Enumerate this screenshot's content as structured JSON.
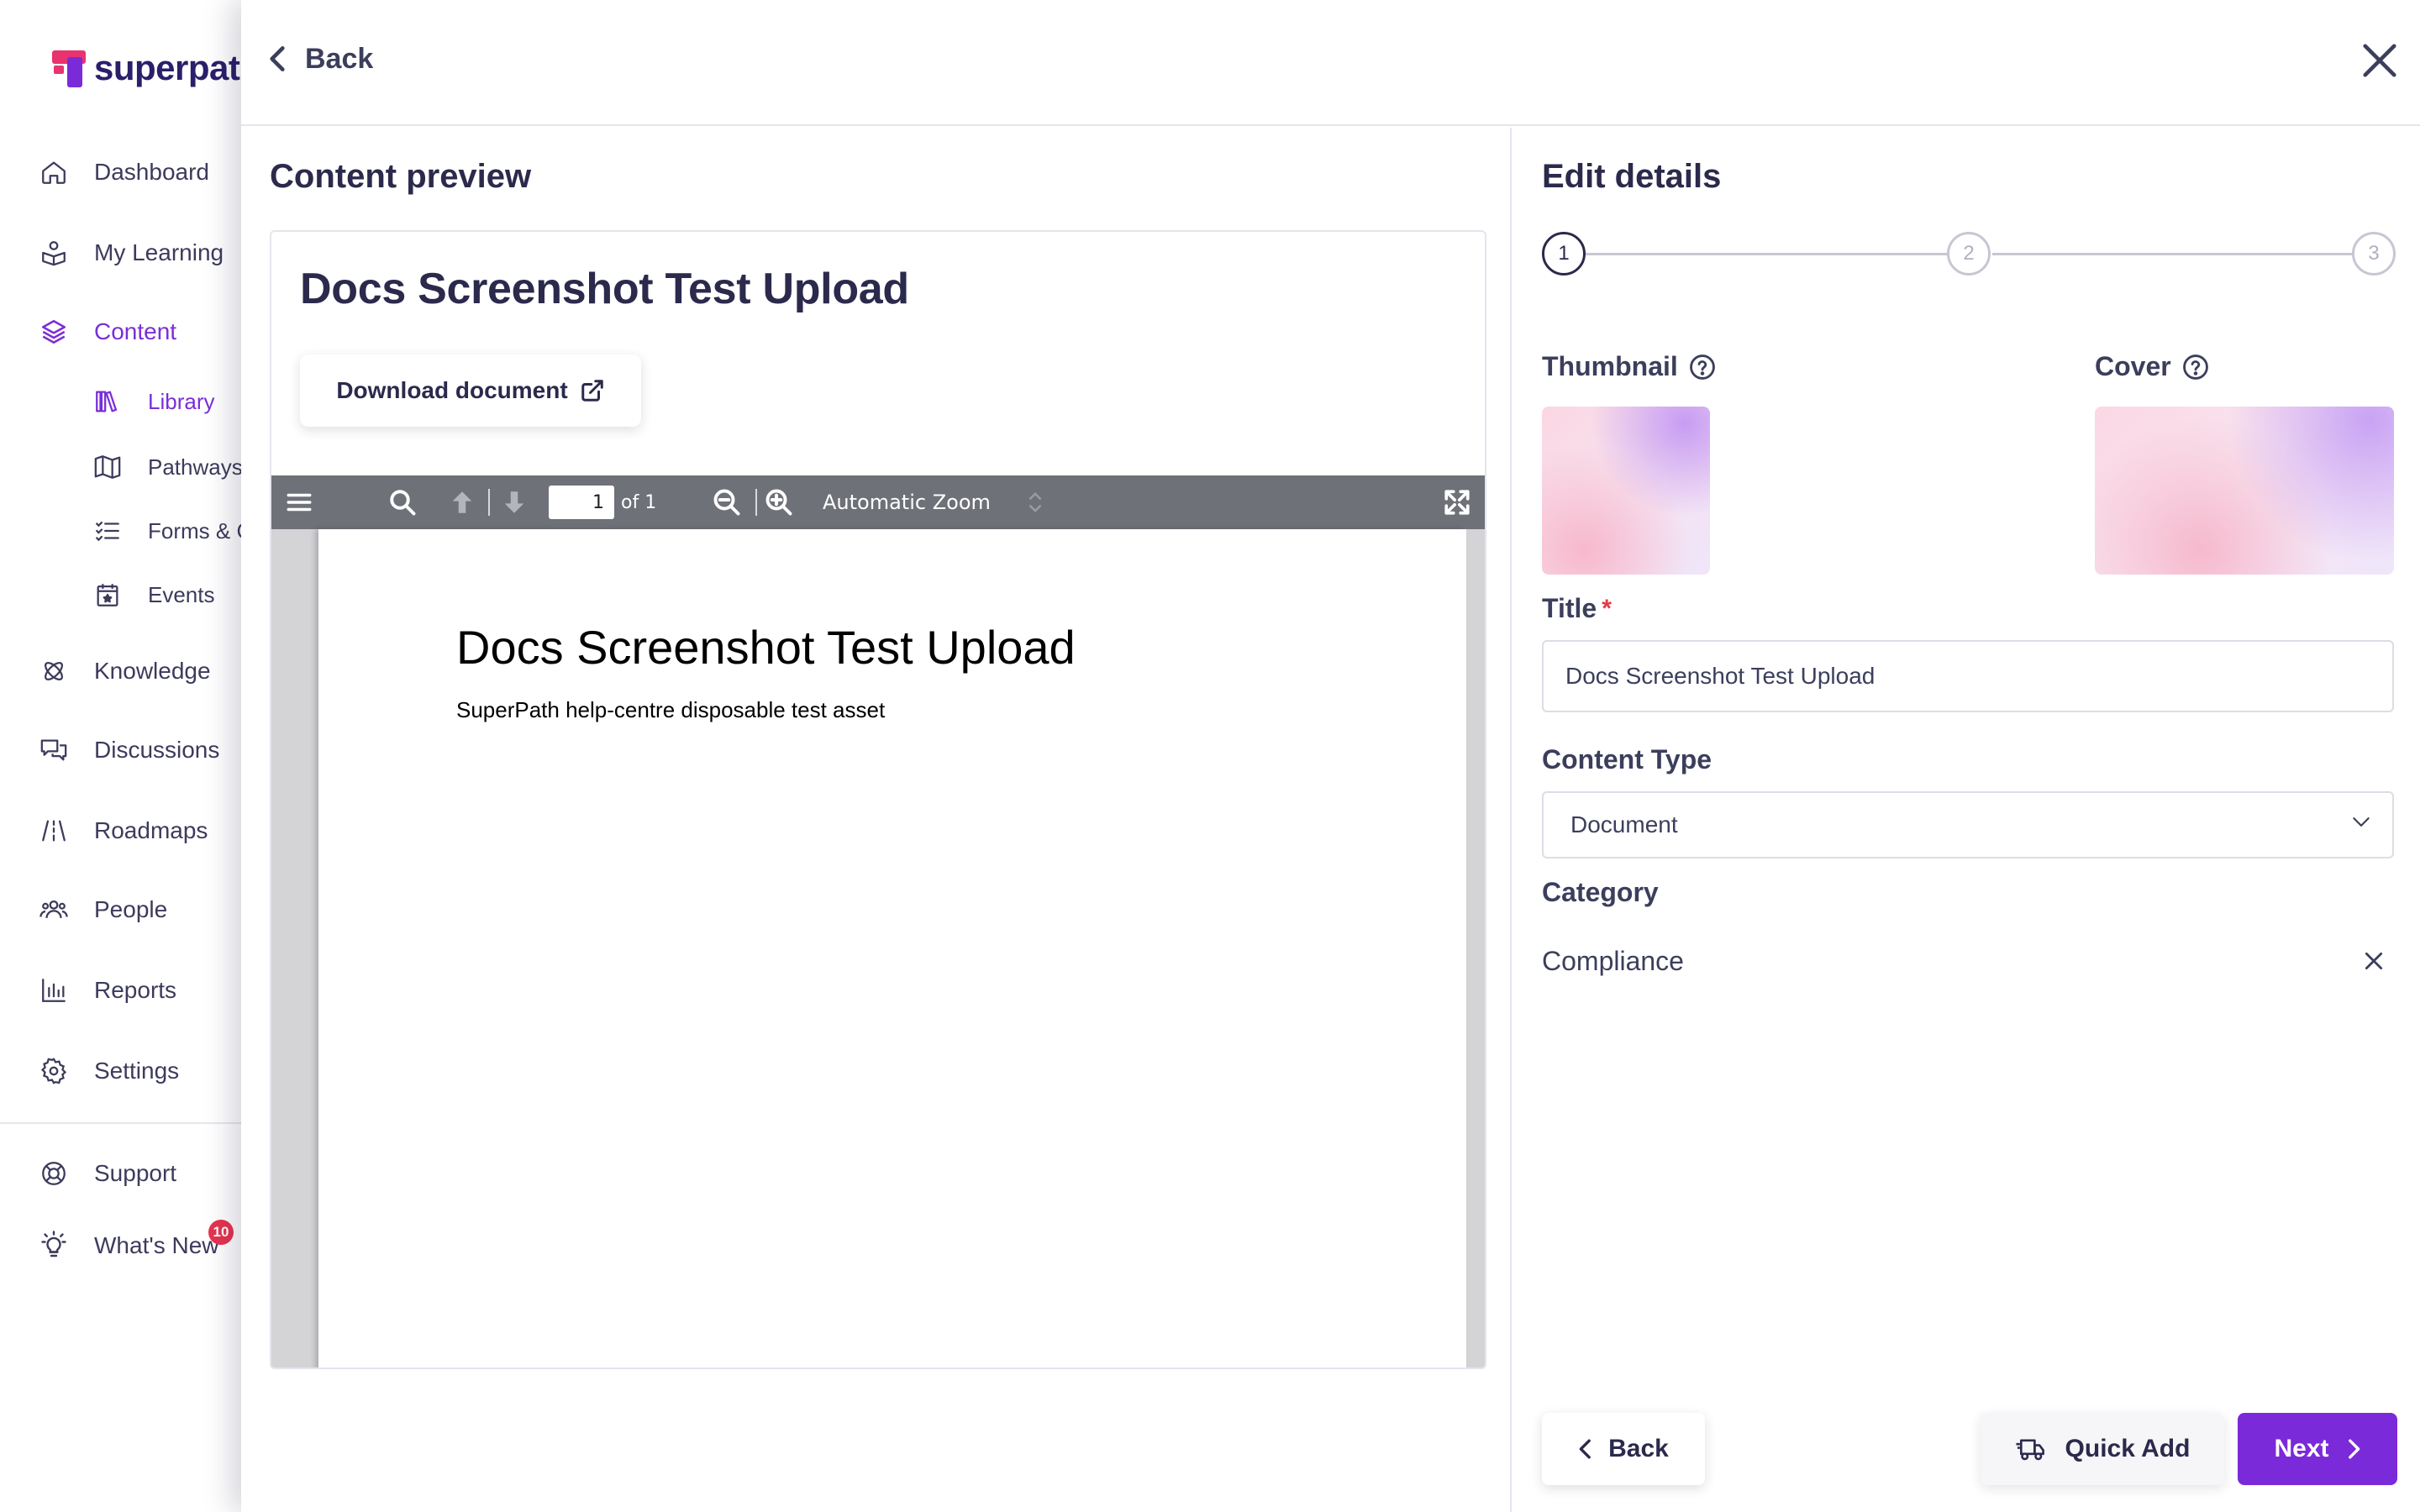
{
  "app": {
    "logo_text": "superpath"
  },
  "sidebar": {
    "items": [
      {
        "label": "Dashboard",
        "icon": "home-icon"
      },
      {
        "label": "My Learning",
        "icon": "learning-icon"
      },
      {
        "label": "Content",
        "icon": "layers-icon"
      },
      {
        "label": "Knowledge",
        "icon": "atom-icon"
      },
      {
        "label": "Discussions",
        "icon": "chat-icon"
      },
      {
        "label": "Roadmaps",
        "icon": "road-icon"
      },
      {
        "label": "People",
        "icon": "people-icon"
      },
      {
        "label": "Reports",
        "icon": "bar-chart-icon"
      },
      {
        "label": "Settings",
        "icon": "gear-icon"
      }
    ],
    "sub_items": [
      {
        "label": "Library",
        "icon": "library-icon"
      },
      {
        "label": "Pathways",
        "icon": "map-icon"
      },
      {
        "label": "Forms & C",
        "icon": "checklist-icon"
      },
      {
        "label": "Events",
        "icon": "calendar-icon"
      }
    ],
    "footer": [
      {
        "label": "Support",
        "icon": "lifebuoy-icon"
      },
      {
        "label": "What's New",
        "icon": "lightbulb-icon",
        "badge": "10"
      }
    ],
    "active_item": "Content",
    "active_sub_item": "Library"
  },
  "drawer": {
    "back_label": "Back",
    "preview": {
      "heading": "Content preview",
      "doc_title": "Docs Screenshot Test Upload",
      "download_label": "Download document",
      "pdf": {
        "page_value": "1",
        "page_of": "of 1",
        "zoom": "Automatic Zoom",
        "page_heading": "Docs Screenshot Test Upload",
        "page_text": "SuperPath help-centre disposable test asset"
      }
    },
    "details": {
      "heading": "Edit details",
      "steps": [
        "1",
        "2",
        "3"
      ],
      "active_step": 1,
      "thumbnail_label": "Thumbnail",
      "cover_label": "Cover",
      "title_label": "Title",
      "required_mark": "*",
      "title_value": "Docs Screenshot Test Upload",
      "content_type_label": "Content Type",
      "content_type_value": "Document",
      "category_label": "Category",
      "category_value": "Compliance"
    },
    "footer": {
      "back_label": "Back",
      "quick_add_label": "Quick Add",
      "next_label": "Next"
    }
  },
  "colors": {
    "accent": "#7a2ad8",
    "text_primary": "#2b2a4c",
    "badge": "#e8334f",
    "required": "#e33a4a",
    "pdf_toolbar": "#6f7178"
  }
}
